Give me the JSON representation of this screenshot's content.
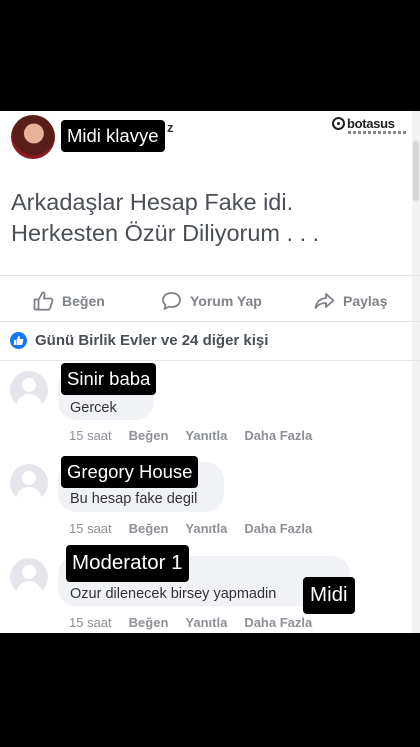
{
  "post": {
    "author_fragment": "z",
    "watermark": "botasus",
    "lines": [
      "Arkadaşlar Hesap Fake idi.",
      "Herkesten Özür Diliyorum . . ."
    ]
  },
  "actions": {
    "like": "Beğen",
    "comment": "Yorum Yap",
    "share": "Paylaş"
  },
  "reactions": "Günü Birlik Evler ve 24 diğer kişi",
  "comments": [
    {
      "text": "Gercek",
      "time": "15 saat",
      "like": "Beğen",
      "reply": "Yanıtla",
      "more": "Daha Fazla"
    },
    {
      "text": "Bu hesap fake degil",
      "time": "15 saat",
      "like": "Beğen",
      "reply": "Yanıtla",
      "more": "Daha Fazla"
    },
    {
      "text": "Ozur dilenecek birsey yapmadin",
      "time": "15 saat",
      "like": "Beğen",
      "reply": "Yanıtla",
      "more": "Daha Fazla"
    }
  ],
  "overlay_labels": {
    "top": "Midi klavye",
    "c1": "Sinir baba",
    "c2": "Gregory House",
    "c3": "Moderator 1",
    "c3_end": "Midi"
  }
}
